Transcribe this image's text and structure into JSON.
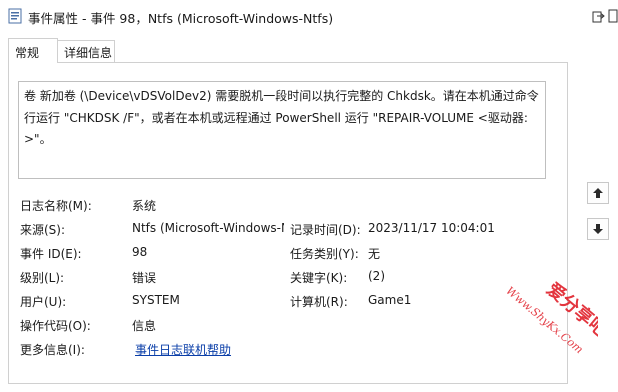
{
  "window": {
    "title": "事件属性 - 事件 98，Ntfs (Microsoft-Windows-Ntfs)"
  },
  "tabs": [
    {
      "label": "常规",
      "active": true
    },
    {
      "label": "详细信息",
      "active": false
    }
  ],
  "description": "卷 新加卷 (\\Device\\vDSVolDev2) 需要脱机一段时间以执行完整的 Chkdsk。请在本机通过命令行运行 \"CHKDSK /F\"，或者在本机或远程通过 PowerShell 运行 \"REPAIR-VOLUME <驱动器:>\"。",
  "fields": {
    "log_name": {
      "label": "日志名称(M):",
      "value": "系统"
    },
    "source": {
      "label": "来源(S):",
      "value": "Ntfs (Microsoft-Windows-Ntfs)"
    },
    "logged": {
      "label": "记录时间(D):",
      "value": "2023/11/17 10:04:01"
    },
    "event_id": {
      "label": "事件 ID(E):",
      "value": "98"
    },
    "task_category": {
      "label": "任务类别(Y):",
      "value": "无"
    },
    "level": {
      "label": "级别(L):",
      "value": "错误"
    },
    "keywords": {
      "label": "关键字(K):",
      "value": "(2)"
    },
    "user": {
      "label": "用户(U):",
      "value": "SYSTEM"
    },
    "computer": {
      "label": "计算机(R):",
      "value": "Game1"
    },
    "opcode": {
      "label": "操作代码(O):",
      "value": "信息"
    },
    "more_info": {
      "label": "更多信息(I):",
      "link": "事件日志联机帮助"
    }
  },
  "watermark": {
    "text_cn": "爱分享吧",
    "text_url": "Www.ShyKx.Com"
  },
  "icons": {
    "app": "event-properties-icon",
    "copy": "copy-icon",
    "up": "arrow-up-icon",
    "down": "arrow-down-icon"
  },
  "colors": {
    "link": "#0a3ea8",
    "watermark": "#e0202a",
    "nav_arrow": "#2a2a2a"
  }
}
